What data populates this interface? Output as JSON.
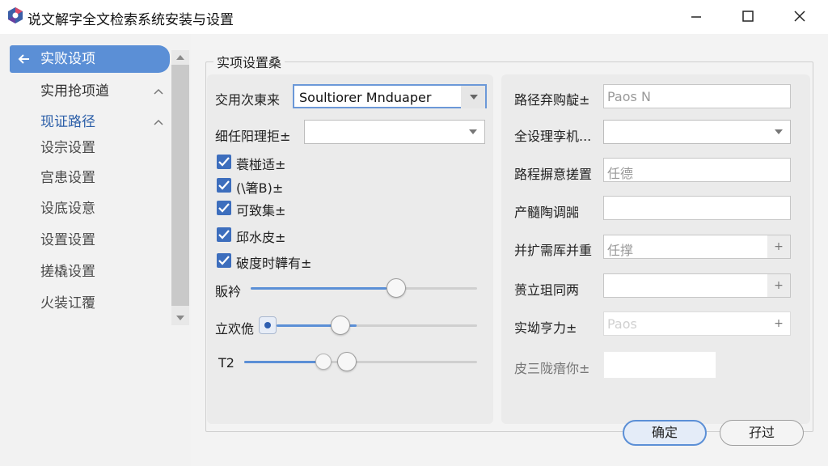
{
  "window": {
    "title": "说文解字全文检索系统安装与设置",
    "controls": [
      "minimize-icon",
      "maximize-icon",
      "close-icon"
    ]
  },
  "sidebar": {
    "items": [
      {
        "label": "实败设项",
        "state": "active",
        "icon": "arrow-left-icon"
      },
      {
        "label": "实用抢项遒",
        "state": "section",
        "icon": "chevron-up-icon"
      },
      {
        "label": "现证路径",
        "state": "section-blue",
        "icon": "chevron-up-icon"
      },
      {
        "label": "设宗设置"
      },
      {
        "label": "宫患设置"
      },
      {
        "label": "设底设意"
      },
      {
        "label": "设置设置"
      },
      {
        "label": "搓橇设置"
      },
      {
        "label": "火装讧覆"
      }
    ]
  },
  "group": {
    "title": "实项设置桑"
  },
  "left": {
    "combo1": {
      "label": "交用次東来",
      "value": "Soultiorer Mnduaper"
    },
    "combo2": {
      "label": "细任阳理拒±",
      "value": ""
    },
    "checkboxes": [
      {
        "label": "蓑椪适±",
        "checked": true
      },
      {
        "label": "(\\箸B)±",
        "checked": true
      },
      {
        "label": "可致集±",
        "checked": true
      },
      {
        "label": "邱水皮±",
        "checked": true
      },
      {
        "label": "破度时韡有±",
        "checked": true
      }
    ],
    "sliders": [
      {
        "label": "販衿",
        "level": 0.6
      },
      {
        "label": "立欢佹",
        "level": 0.4
      },
      {
        "label": "T2",
        "level": 0.34,
        "secondary_level": 0.3
      }
    ]
  },
  "right": {
    "fields": [
      {
        "label": "路径弃购靛±",
        "kind": "text",
        "placeholder": "Paos N"
      },
      {
        "label": "全设理孪机...",
        "kind": "dropdown",
        "placeholder": ""
      },
      {
        "label": "路程摒意搓置",
        "kind": "text",
        "placeholder": "任德"
      },
      {
        "label": "产髓陶调嘂",
        "kind": "text",
        "placeholder": ""
      },
      {
        "label": "并扩需厍并重",
        "kind": "spin",
        "placeholder": "任撑",
        "spin_symbol": "+"
      },
      {
        "label": "蒉立珇同两",
        "kind": "spin",
        "placeholder": "",
        "spin_symbol": "+"
      },
      {
        "label": "实坳亨力±",
        "kind": "spin",
        "placeholder": "Paos",
        "spin_symbol": "+"
      },
      {
        "label": "皮三陇瘖你±",
        "kind": "text",
        "placeholder": ""
      }
    ]
  },
  "buttons": {
    "ok": "确定",
    "cancel": "孖过"
  },
  "colors": {
    "accent": "#5b8fd6",
    "check": "#3d6ebd",
    "link": "#2b5ea8"
  }
}
